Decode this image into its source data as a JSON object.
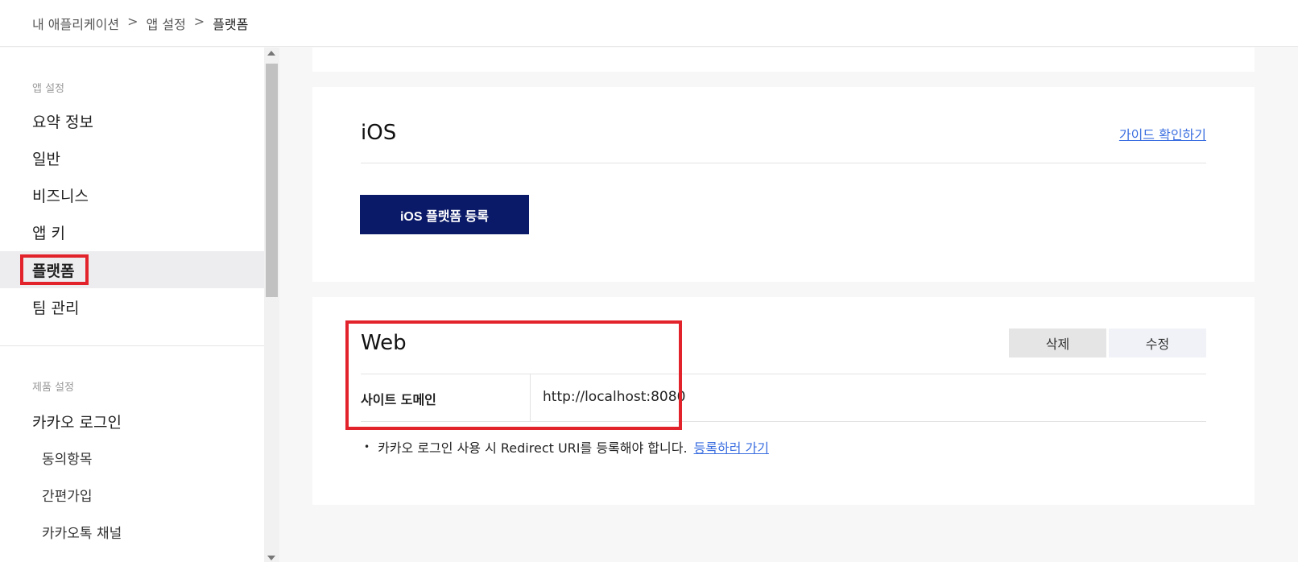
{
  "breadcrumb": {
    "items": [
      "내 애플리케이션",
      "앱 설정",
      "플랫폼"
    ],
    "separator": ">"
  },
  "sidebar": {
    "section1_title": "앱 설정",
    "items": [
      {
        "label": "요약 정보"
      },
      {
        "label": "일반"
      },
      {
        "label": "비즈니스"
      },
      {
        "label": "앱 키"
      },
      {
        "label": "플랫폼",
        "active": true
      },
      {
        "label": "팀 관리"
      }
    ],
    "section2_title": "제품 설정",
    "product_items": [
      {
        "label": "카카오 로그인"
      }
    ],
    "sub_items": [
      {
        "label": "동의항목"
      },
      {
        "label": "간편가입"
      },
      {
        "label": "카카오톡 채널"
      }
    ]
  },
  "ios": {
    "title": "iOS",
    "guide_link": "가이드 확인하기",
    "register_button": "iOS 플랫폼 등록"
  },
  "web": {
    "title": "Web",
    "delete_button": "삭제",
    "edit_button": "수정",
    "site_domain_label": "사이트 도메인",
    "site_domain_value": "http://localhost:8080",
    "note_bullet": "•",
    "note_text": "카카오 로그인 사용 시 Redirect URI를 등록해야 합니다.",
    "note_link": "등록하러 가기"
  },
  "colors": {
    "accent_navy": "#0b1a68",
    "link_blue": "#3b6ee0",
    "highlight_red": "#e3232b",
    "active_bg": "#ededf0"
  }
}
